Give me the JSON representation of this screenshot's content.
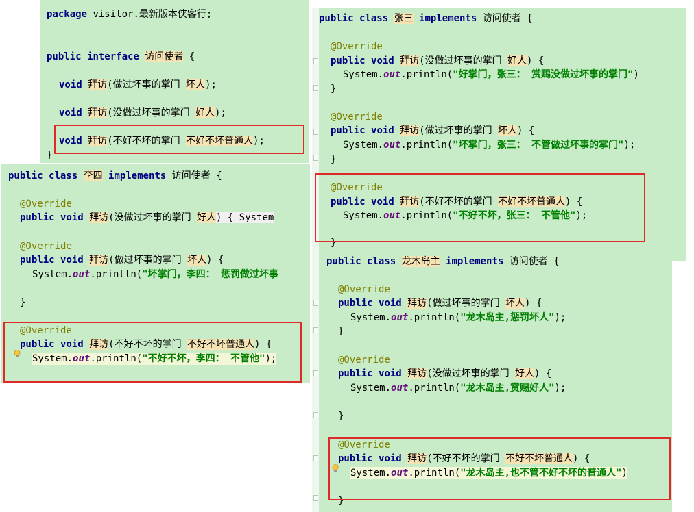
{
  "interface_panel": {
    "package_kw": "package",
    "package_name": "visitor.最新版本侠客行;",
    "public_kw": "public",
    "interface_kw": "interface",
    "interface_name": "访问使者",
    "open_brace": "{",
    "close_brace": "}",
    "methods": [
      {
        "ret": "void",
        "name": "拜访",
        "param_type": "做过坏事的掌门",
        "param_name": "坏人",
        "end": ");"
      },
      {
        "ret": "void",
        "name": "拜访",
        "param_type": "没做过坏事的掌门",
        "param_name": "好人",
        "end": ");"
      },
      {
        "ret": "void",
        "name": "拜访",
        "param_type": "不好不坏的掌门",
        "param_name": "不好不坏普通人",
        "end": ");"
      }
    ]
  },
  "zhangsan_panel": {
    "header": {
      "public": "public",
      "class": "class",
      "name": "张三",
      "implements": "implements",
      "iface": "访问使者",
      "brace": "{"
    },
    "methods": [
      {
        "annotation": "@Override",
        "sig_public": "public",
        "sig_void": "void",
        "name": "拜访",
        "param_type": "没做过坏事的掌门",
        "param_name": "好人",
        "sig_end": ") {",
        "call_prefix": "System.",
        "call_field": "out",
        "call_method": ".println(",
        "message": "\"好掌门，张三： 赏赐没做过坏事的掌门\"",
        "call_end": ")",
        "close": "}"
      },
      {
        "annotation": "@Override",
        "sig_public": "public",
        "sig_void": "void",
        "name": "拜访",
        "param_type": "做过坏事的掌门",
        "param_name": "坏人",
        "sig_end": ") {",
        "call_prefix": "System.",
        "call_field": "out",
        "call_method": ".println(",
        "message": "\"坏掌门，张三： 不管做过坏事的掌门\"",
        "call_end": ");",
        "close": "}"
      },
      {
        "annotation": "@Override",
        "sig_public": "public",
        "sig_void": "void",
        "name": "拜访",
        "param_type": "不好不坏的掌门",
        "param_name": "不好不坏普通人",
        "sig_end": ") {",
        "call_prefix": "System.",
        "call_field": "out",
        "call_method": ".println(",
        "message": "\"不好不坏，张三： 不管他\"",
        "call_end": ");",
        "close": "}"
      }
    ]
  },
  "lisi_panel": {
    "header": {
      "public": "public",
      "class": "class",
      "name": "李四",
      "implements": "implements",
      "iface": "访问使者",
      "brace": "{"
    },
    "method1": {
      "annotation": "@Override",
      "sig_public": "public",
      "sig_void": "void",
      "name": "拜访",
      "param_type": "没做过坏事的掌门",
      "param_name": "好人",
      "sig_end": ") { System"
    },
    "method2": {
      "annotation": "@Override",
      "sig_public": "public",
      "sig_void": "void",
      "name": "拜访",
      "param_type": "做过坏事的掌门",
      "param_name": "坏人",
      "sig_end": ") {",
      "call_prefix": "System.",
      "call_field": "out",
      "call_method": ".println(",
      "message": "\"坏掌门，李四： 惩罚做过坏事",
      "close": "}"
    },
    "method3": {
      "annotation": "@Override",
      "sig_public": "public",
      "sig_void": "void",
      "name": "拜访",
      "param_type": "不好不坏的掌门",
      "param_name": "不好不坏普通人",
      "sig_end": ") {",
      "call_prefix": "System.",
      "call_field": "out",
      "call_method": ".println(",
      "message": "\"不好不坏，李四： 不管他\"",
      "call_end": ");"
    }
  },
  "longmu_panel": {
    "header": {
      "public": "public",
      "class": "class",
      "name": "龙木岛主",
      "implements": "implements",
      "iface": "访问使者",
      "brace": "{"
    },
    "methods": [
      {
        "annotation": "@Override",
        "sig_public": "public",
        "sig_void": "void",
        "name": "拜访",
        "param_type": "做过坏事的掌门",
        "param_name": "坏人",
        "sig_end": ") {",
        "call_prefix": "System.",
        "call_field": "out",
        "call_method": ".println(",
        "message": "\"龙木岛主,惩罚坏人\"",
        "call_end": ");",
        "close": "}"
      },
      {
        "annotation": "@Override",
        "sig_public": "public",
        "sig_void": "void",
        "name": "拜访",
        "param_type": "没做过坏事的掌门",
        "param_name": "好人",
        "sig_end": ") {",
        "call_prefix": "System.",
        "call_field": "out",
        "call_method": ".println(",
        "message": "\"龙木岛主,赏赐好人\"",
        "call_end": ");",
        "close": "}"
      },
      {
        "annotation": "@Override",
        "sig_public": "public",
        "sig_void": "void",
        "name": "拜访",
        "param_type": "不好不坏的掌门",
        "param_name": "不好不坏普通人",
        "sig_end": ") {",
        "call_prefix": "System.",
        "call_field": "out",
        "call_method": ".println(",
        "message": "\"龙木岛主,也不管不好不坏的普通人\"",
        "call_end": ")",
        "close": "}"
      }
    ]
  },
  "colors": {
    "panel_bg": "#c8ebc8",
    "keyword": "#000080",
    "annotation": "#808000",
    "string": "#008000",
    "highlight": "#f6e3b4",
    "red_box": "#e02a2a"
  },
  "icons": {
    "fold": "fold-marker-icon",
    "bulb": "lightbulb-icon"
  }
}
